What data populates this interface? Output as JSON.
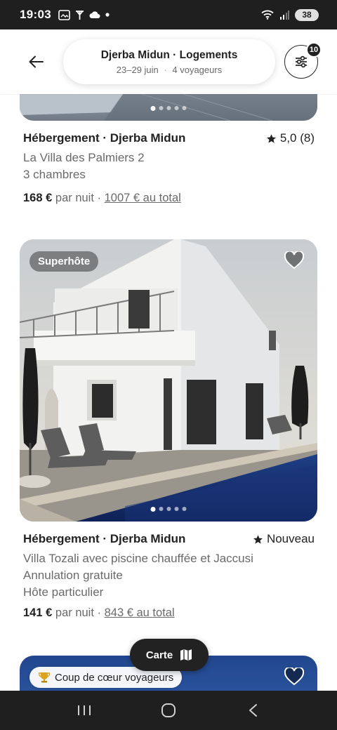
{
  "status_bar": {
    "time": "19:03",
    "battery": "38",
    "icons": [
      "gallery-icon",
      "antenna-icon",
      "cloud-icon",
      "dot-icon",
      "wifi-icon",
      "signal-icon"
    ]
  },
  "header": {
    "back_icon": "arrow-left-icon",
    "search_title": "Djerba Midun · Logements",
    "dates": "23–29 juin",
    "separator": "·",
    "guests": "4 voyageurs",
    "filter_count": "10",
    "filter_icon": "sliders-icon"
  },
  "listings": [
    {
      "type": "Hébergement · Djerba Midun",
      "rating": "5,0 (8)",
      "name": "La Villa des Palmiers 2",
      "detail": "3 chambres",
      "price": "168 €",
      "per_night": "par nuit",
      "sep": "·",
      "total": "1007 € au total"
    },
    {
      "badge": "Superhôte",
      "type": "Hébergement · Djerba Midun",
      "rating": "Nouveau",
      "name": "Villa Tozali avec piscine chauffée et Jaccusi",
      "detail1": "Annulation gratuite",
      "detail2": "Hôte particulier",
      "price": "141 €",
      "per_night": "par nuit",
      "sep": "·",
      "total": "843 € au total"
    },
    {
      "badge": "Coup de cœur voyageurs"
    }
  ],
  "map_button": {
    "label": "Carte",
    "icon": "map-icon"
  },
  "colors": {
    "text": "#222222",
    "muted": "#6a6a6a",
    "bar": "#1f1f1f"
  }
}
